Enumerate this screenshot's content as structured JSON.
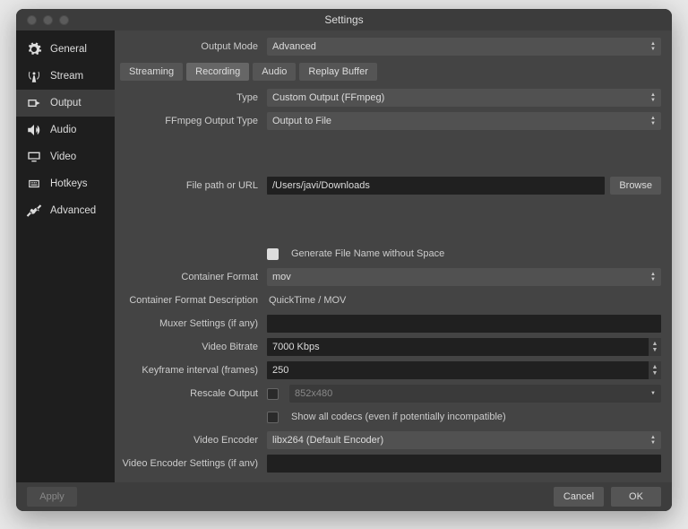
{
  "window": {
    "title": "Settings"
  },
  "sidebar": {
    "items": [
      {
        "label": "General"
      },
      {
        "label": "Stream"
      },
      {
        "label": "Output"
      },
      {
        "label": "Audio"
      },
      {
        "label": "Video"
      },
      {
        "label": "Hotkeys"
      },
      {
        "label": "Advanced"
      }
    ],
    "selected_index": 2
  },
  "output_mode": {
    "label": "Output Mode",
    "value": "Advanced"
  },
  "tabs": {
    "items": [
      {
        "label": "Streaming"
      },
      {
        "label": "Recording"
      },
      {
        "label": "Audio"
      },
      {
        "label": "Replay Buffer"
      }
    ],
    "active_index": 1
  },
  "form": {
    "type": {
      "label": "Type",
      "value": "Custom Output (FFmpeg)"
    },
    "ffmpeg_output_type": {
      "label": "FFmpeg Output Type",
      "value": "Output to File"
    },
    "file_path": {
      "label": "File path or URL",
      "value": "/Users/javi/Downloads",
      "browse": "Browse"
    },
    "generate_no_space": {
      "label": "Generate File Name without Space",
      "checked": false
    },
    "container_format": {
      "label": "Container Format",
      "value": "mov"
    },
    "container_desc": {
      "label": "Container Format Description",
      "value": "QuickTime / MOV"
    },
    "muxer": {
      "label": "Muxer Settings (if any)",
      "value": ""
    },
    "video_bitrate": {
      "label": "Video Bitrate",
      "value": "7000 Kbps"
    },
    "keyframe_interval": {
      "label": "Keyframe interval (frames)",
      "value": "250"
    },
    "rescale": {
      "label": "Rescale Output",
      "checked": false,
      "value": "852x480"
    },
    "show_all_codecs": {
      "label": "Show all codecs (even if potentially incompatible)",
      "checked": false
    },
    "video_encoder": {
      "label": "Video Encoder",
      "value": "libx264 (Default Encoder)"
    },
    "video_encoder_settings": {
      "label": "Video Encoder Settings (if anv)",
      "value": ""
    }
  },
  "footer": {
    "apply": "Apply",
    "cancel": "Cancel",
    "ok": "OK"
  }
}
